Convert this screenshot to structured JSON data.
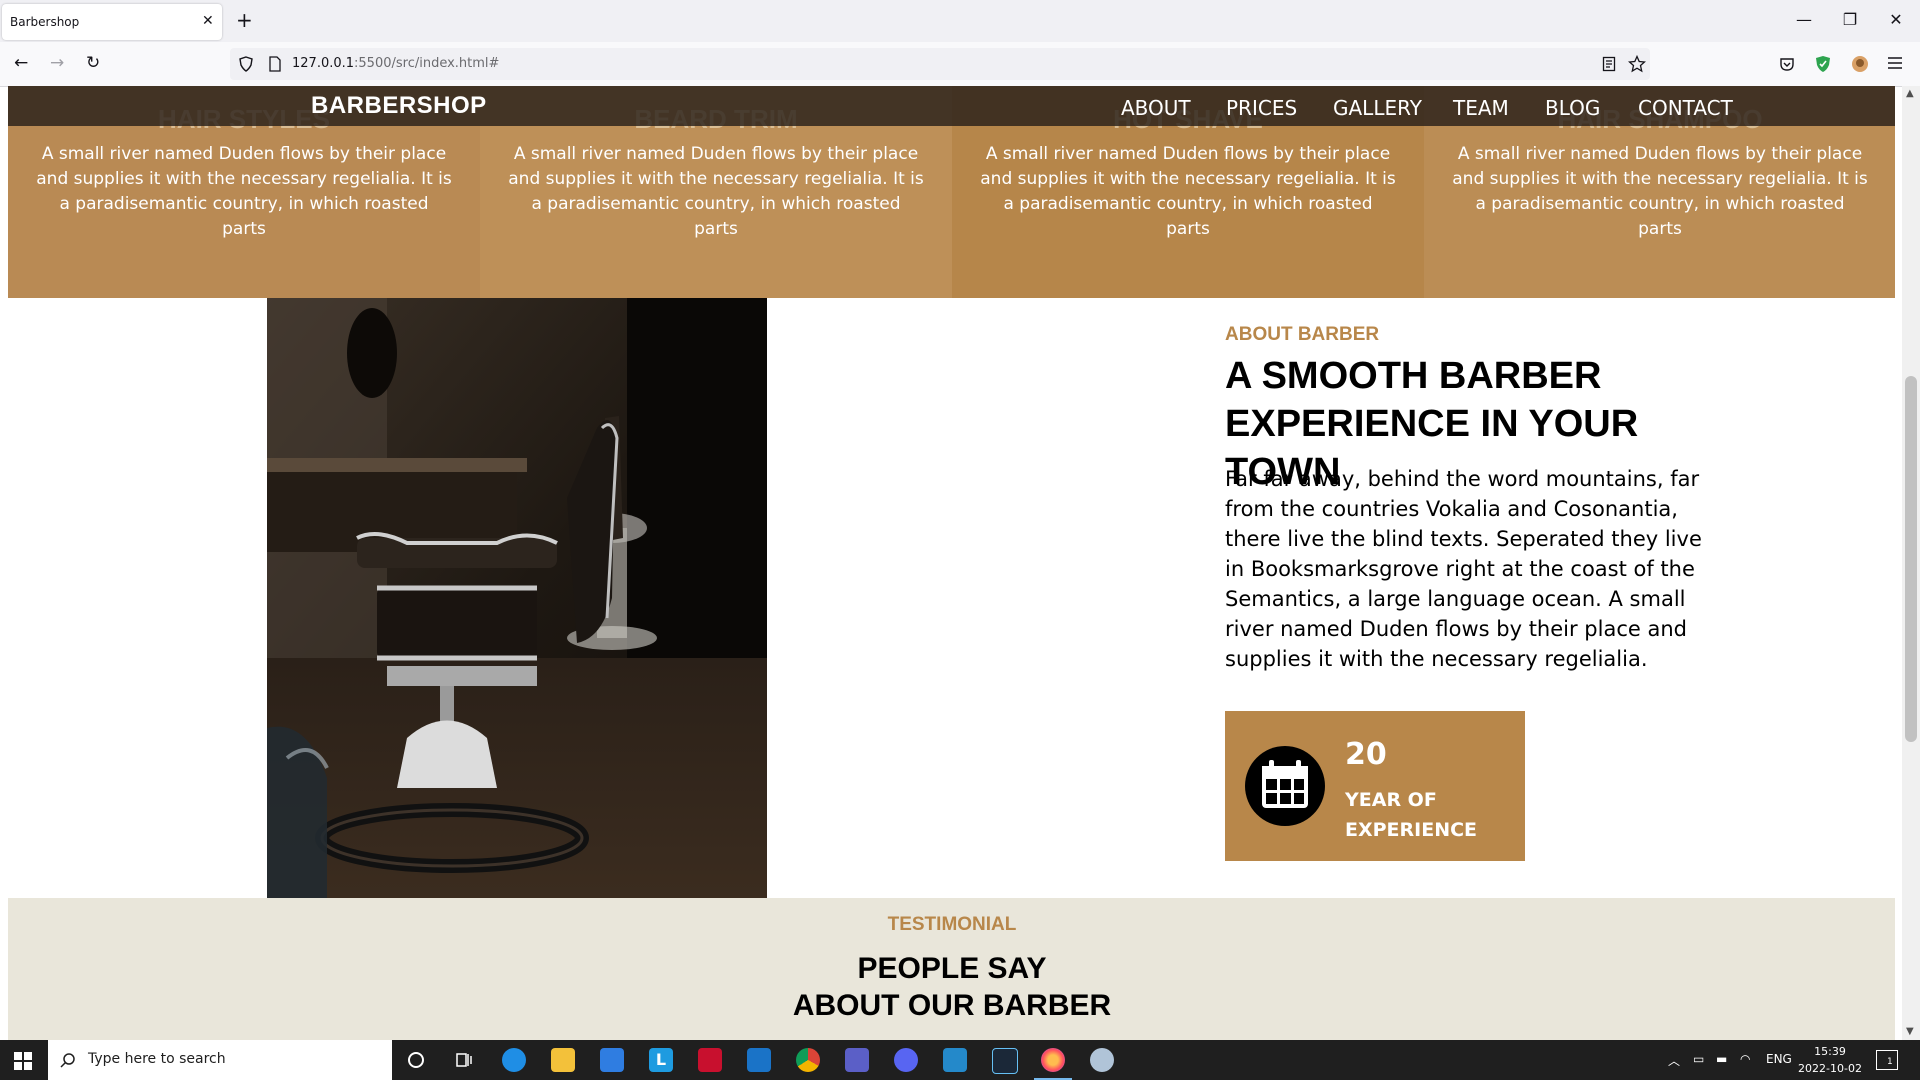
{
  "browser": {
    "tab_title": "Barbershop",
    "tab_close": "✕",
    "new_tab": "+",
    "url_host": "127.0.0.1",
    "url_rest": ":5500/src/index.html#",
    "window_minimize": "—",
    "window_restore": "❐",
    "window_close": "✕"
  },
  "services": [
    {
      "title": "HAIR STYLES",
      "text": "A small river named Duden flows by their place and supplies it with the necessary regelialia. It is a paradisemantic country, in which roasted parts",
      "color": "#b98a54"
    },
    {
      "title": "BEARD TRIM",
      "text": "A small river named Duden flows by their place and supplies it with the necessary regelialia. It is a paradisemantic country, in which roasted parts",
      "color": "#be9058"
    },
    {
      "title": "HOT SHAVE",
      "text": "A small river named Duden flows by their place and supplies it with the necessary regelialia. It is a paradisemantic country, in which roasted parts",
      "color": "#b6864a"
    },
    {
      "title": "HAIR SHAMPOO",
      "text": "A small river named Duden flows by their place and supplies it with the necessary regelialia. It is a paradisemantic country, in which roasted parts",
      "color": "#bb8d55"
    }
  ],
  "header": {
    "brand": "BARBERSHOP",
    "menu": [
      "ABOUT",
      "PRICES",
      "GALLERY",
      "TEAM",
      "BLOG",
      "CONTACT"
    ]
  },
  "about": {
    "eyebrow": "ABOUT BARBER",
    "heading": "A SMOOTH BARBER EXPERIENCE IN YOUR TOWN",
    "text": "Far far away, behind the word mountains, far from the countries Vokalia and Cosonantia, there live the blind texts. Seperated they live in Booksmarksgrove right at the coast of the Semantics, a large language ocean. A small river named Duden flows by their place and supplies it with the necessary regelialia.",
    "experience_number": "20",
    "experience_label": "YEAR OF EXPERIENCE",
    "accent_color": "#b8874a"
  },
  "testimonial": {
    "eyebrow": "TESTIMONIAL",
    "heading_line1": "PEOPLE SAY",
    "heading_line2": "ABOUT OUR BARBER"
  },
  "taskbar": {
    "search_placeholder": "Type here to search",
    "language": "ENG",
    "time": "15:39",
    "date": "2022-10-02",
    "notification_count": "1"
  }
}
